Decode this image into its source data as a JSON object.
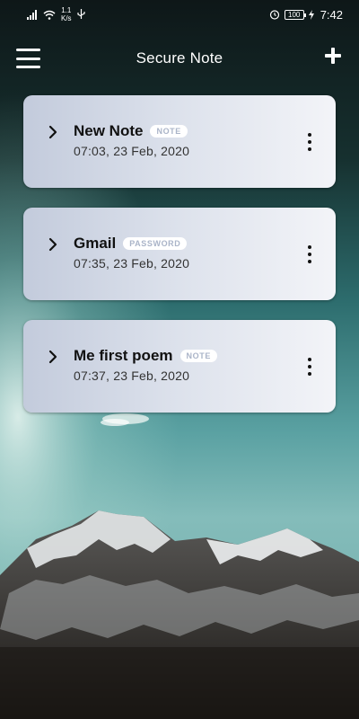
{
  "status_bar": {
    "net_speed_value": "1.1",
    "net_speed_unit": "K/s",
    "battery": "100",
    "time": "7:42"
  },
  "app_bar": {
    "title": "Secure Note"
  },
  "notes": [
    {
      "title": "New Note",
      "tag": "NOTE",
      "date": "07:03, 23 Feb, 2020"
    },
    {
      "title": "Gmail",
      "tag": "PASSWORD",
      "date": "07:35, 23 Feb, 2020"
    },
    {
      "title": "Me first poem",
      "tag": "NOTE",
      "date": "07:37, 23 Feb, 2020"
    }
  ],
  "icons": {
    "menu": "menu-icon",
    "add": "plus-icon",
    "expand": "chevron-right-icon",
    "more": "more-vertical-icon"
  }
}
